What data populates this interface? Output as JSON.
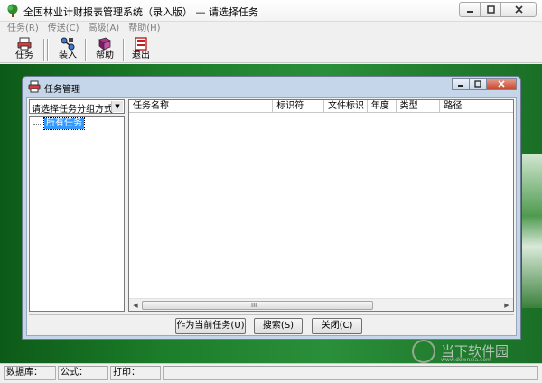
{
  "window": {
    "title": "全国林业计财报表管理系统（录入版） — 请选择任务"
  },
  "menu": [
    {
      "label": "任务(R)"
    },
    {
      "label": "传送(C)"
    },
    {
      "label": "高级(A)"
    },
    {
      "label": "帮助(H)"
    }
  ],
  "toolbar": {
    "task_label": "任务",
    "load_label": "装入",
    "help_label": "帮助",
    "exit_label": "退出"
  },
  "dialog": {
    "title": "任务管理",
    "group_select": "请选择任务分组方式",
    "tree_root": "所有任务",
    "columns": [
      "任务名称",
      "标识符",
      "文件标识",
      "年度",
      "类型",
      "路径"
    ],
    "scroll_grip": "III",
    "buttons": {
      "set_current": "作为当前任务(U)",
      "search": "搜索(S)",
      "close": "关闭(C)"
    }
  },
  "statusbar": {
    "database": "数据库：",
    "formula": "公式：",
    "print": "打印："
  },
  "watermark": {
    "text": "当下软件园",
    "url": "www.downxia.com"
  },
  "colors": {
    "workspace": "#1f7a2c",
    "selection": "#3399ff",
    "dialog_frame": "#c6d6ea"
  }
}
